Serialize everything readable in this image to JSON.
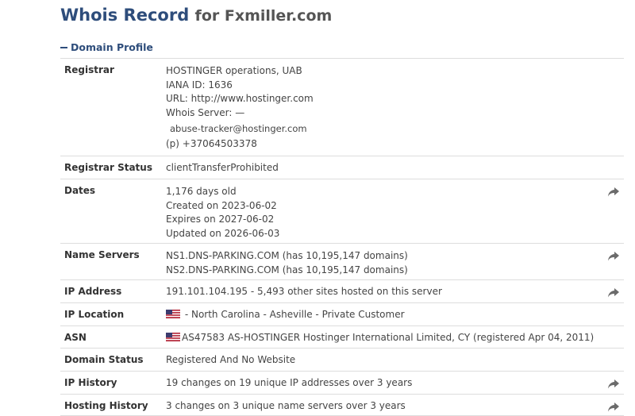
{
  "header": {
    "title": "Whois Record",
    "for_text": "for Fxmiller.com"
  },
  "section": {
    "label": "Domain Profile"
  },
  "rows": {
    "registrar": {
      "label": "Registrar",
      "name": "HOSTINGER operations, UAB",
      "iana": "IANA ID: 1636",
      "url": "URL: http://www.hostinger.com",
      "whois": "Whois Server: —",
      "email": "abuse-tracker@hostinger.com",
      "phone": "(p) +37064503378"
    },
    "registrar_status": {
      "label": "Registrar Status",
      "value": "clientTransferProhibited"
    },
    "dates": {
      "label": "Dates",
      "age": "1,176 days old",
      "created": "Created on 2023-06-02",
      "expires": "Expires on 2027-06-02",
      "updated": "Updated on 2026-06-03"
    },
    "name_servers": {
      "label": "Name Servers",
      "ns1": "NS1.DNS-PARKING.COM (has 10,195,147 domains)",
      "ns2": "NS2.DNS-PARKING.COM (has 10,195,147 domains)"
    },
    "ip_address": {
      "label": "IP Address",
      "value": "191.101.104.195 - 5,493 other sites hosted on this server"
    },
    "ip_location": {
      "label": "IP Location",
      "value": "- North Carolina - Asheville - Private Customer"
    },
    "asn": {
      "label": "ASN",
      "value": "AS47583 AS-HOSTINGER Hostinger International Limited, CY (registered Apr 04, 2011)"
    },
    "domain_status": {
      "label": "Domain Status",
      "value": "Registered And No Website"
    },
    "ip_history": {
      "label": "IP History",
      "value": "19 changes on 19 unique IP addresses over 3 years"
    },
    "hosting_history": {
      "label": "Hosting History",
      "value": "3 changes on 3 unique name servers over 3 years"
    }
  },
  "icons": {
    "share": "share-arrow-icon",
    "flag": "us-flag-icon"
  },
  "colors": {
    "title": "#2e4d7b",
    "border": "#dddddd",
    "share_icon": "#6b6b6b"
  }
}
